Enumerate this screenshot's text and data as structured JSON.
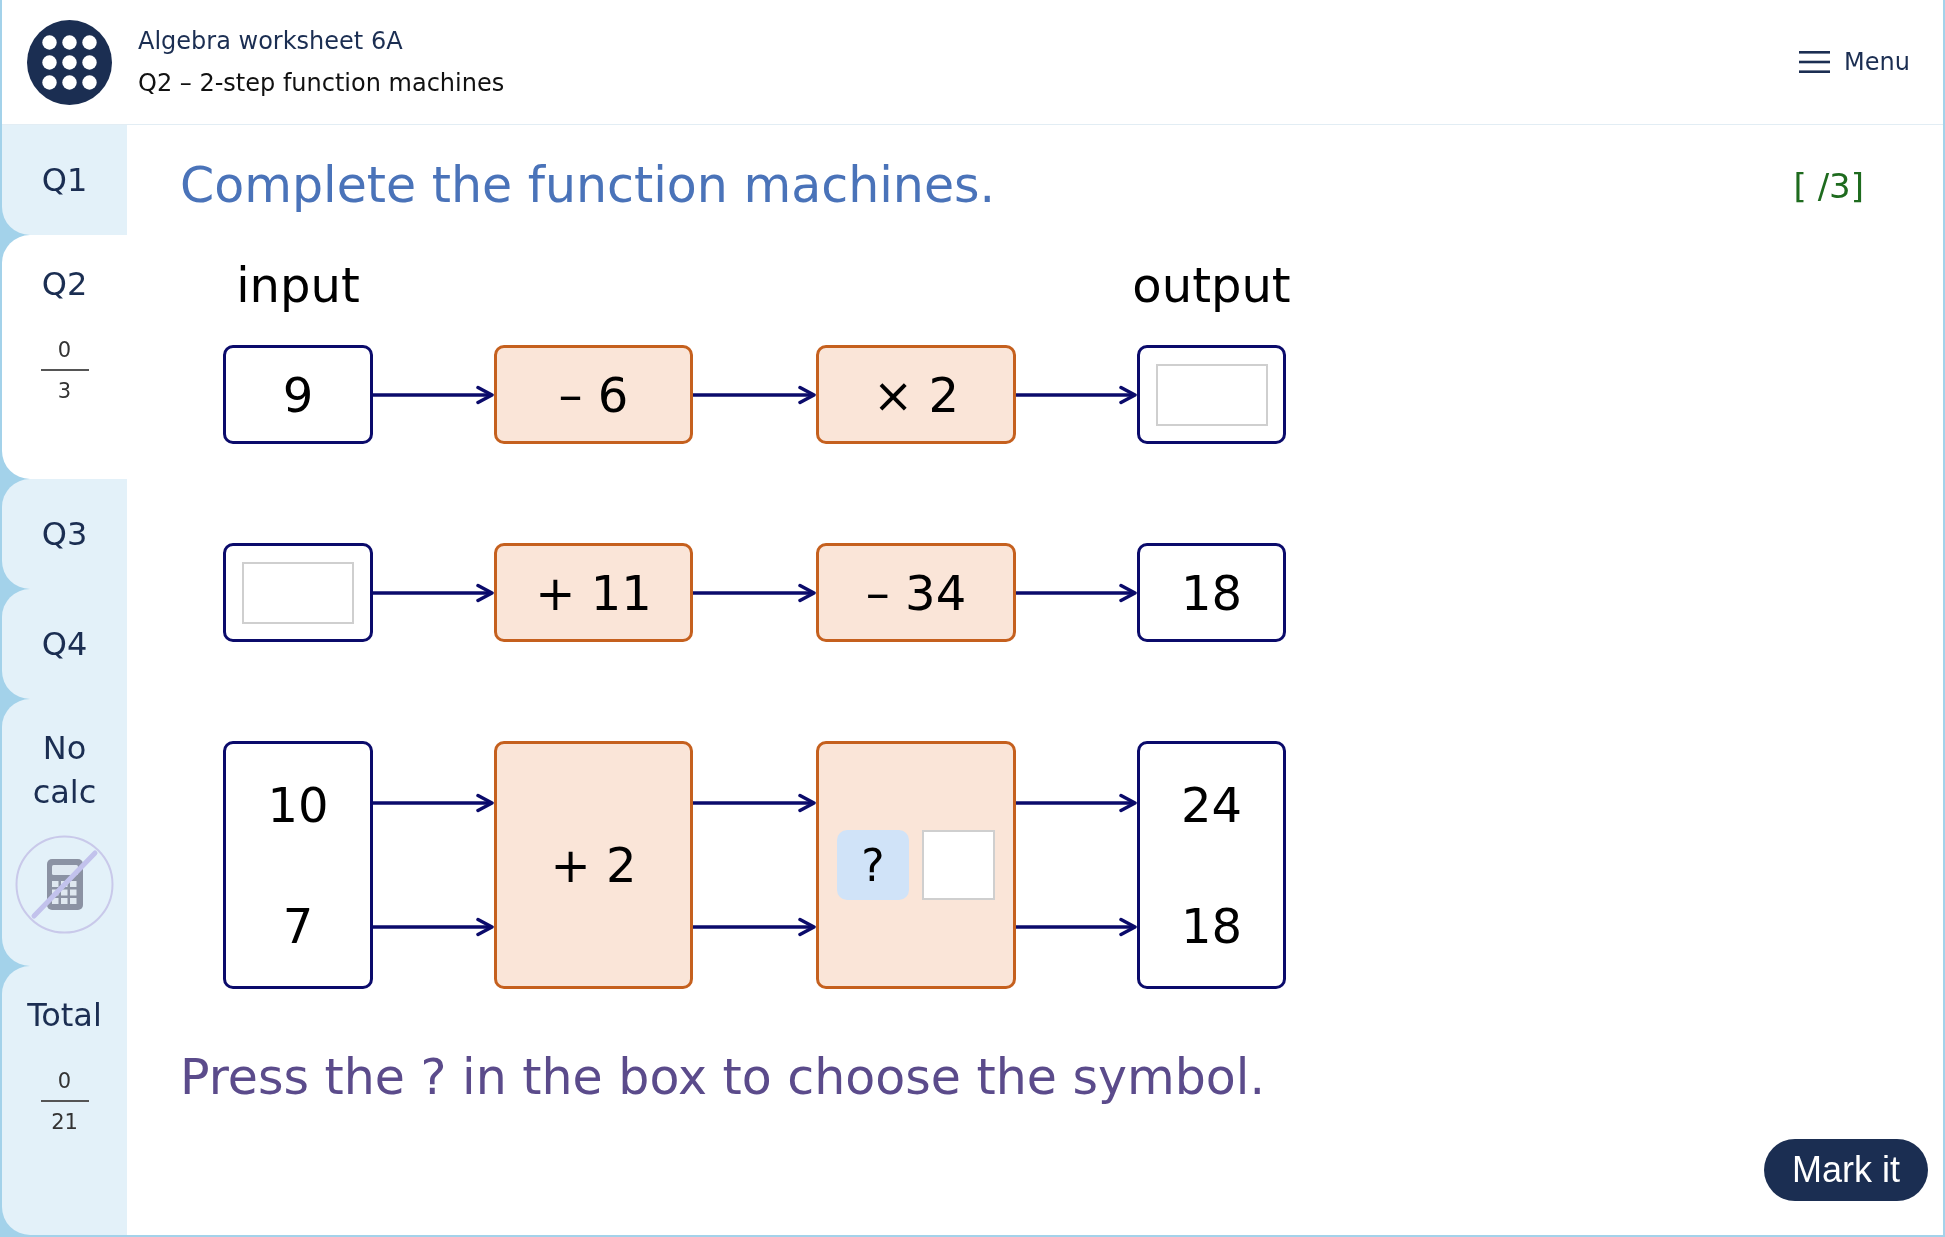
{
  "header": {
    "title": "Algebra worksheet 6A",
    "subtitle": "Q2 – 2-step function machines",
    "menu_label": "Menu"
  },
  "sidebar": {
    "items": [
      {
        "kind": "question",
        "label": "Q1",
        "selected": false
      },
      {
        "kind": "question",
        "label": "Q2",
        "selected": true,
        "score": "0",
        "out_of": "3"
      },
      {
        "kind": "question",
        "label": "Q3",
        "selected": false
      },
      {
        "kind": "question",
        "label": "Q4",
        "selected": false
      },
      {
        "kind": "calculator",
        "label": "No calc",
        "selected": false,
        "allowed": false
      },
      {
        "kind": "total",
        "label": "Total",
        "selected": false,
        "score": "0",
        "out_of": "21"
      }
    ]
  },
  "question": {
    "prompt": "Complete the function machines.",
    "marks": "[ /3]",
    "input_heading": "input",
    "output_heading": "output",
    "machines": [
      {
        "inputs": [
          {
            "kind": "value",
            "text": "9"
          }
        ],
        "steps": [
          {
            "kind": "operation",
            "text": "– 6"
          },
          {
            "kind": "operation",
            "text": "× 2"
          }
        ],
        "outputs": [
          {
            "kind": "blank"
          }
        ]
      },
      {
        "inputs": [
          {
            "kind": "blank"
          }
        ],
        "steps": [
          {
            "kind": "operation",
            "text": "+ 11"
          },
          {
            "kind": "operation",
            "text": "– 34"
          }
        ],
        "outputs": [
          {
            "kind": "value",
            "text": "18"
          }
        ]
      },
      {
        "inputs": [
          {
            "kind": "value",
            "text": "10"
          },
          {
            "kind": "value",
            "text": "7"
          }
        ],
        "steps": [
          {
            "kind": "operation",
            "text": "+ 2"
          },
          {
            "kind": "choice",
            "button": "?"
          }
        ],
        "outputs": [
          {
            "kind": "value",
            "text": "24"
          },
          {
            "kind": "value",
            "text": "18"
          }
        ]
      }
    ],
    "hint": "Press the ? in the box to choose the symbol."
  },
  "mark_button": "Mark it"
}
